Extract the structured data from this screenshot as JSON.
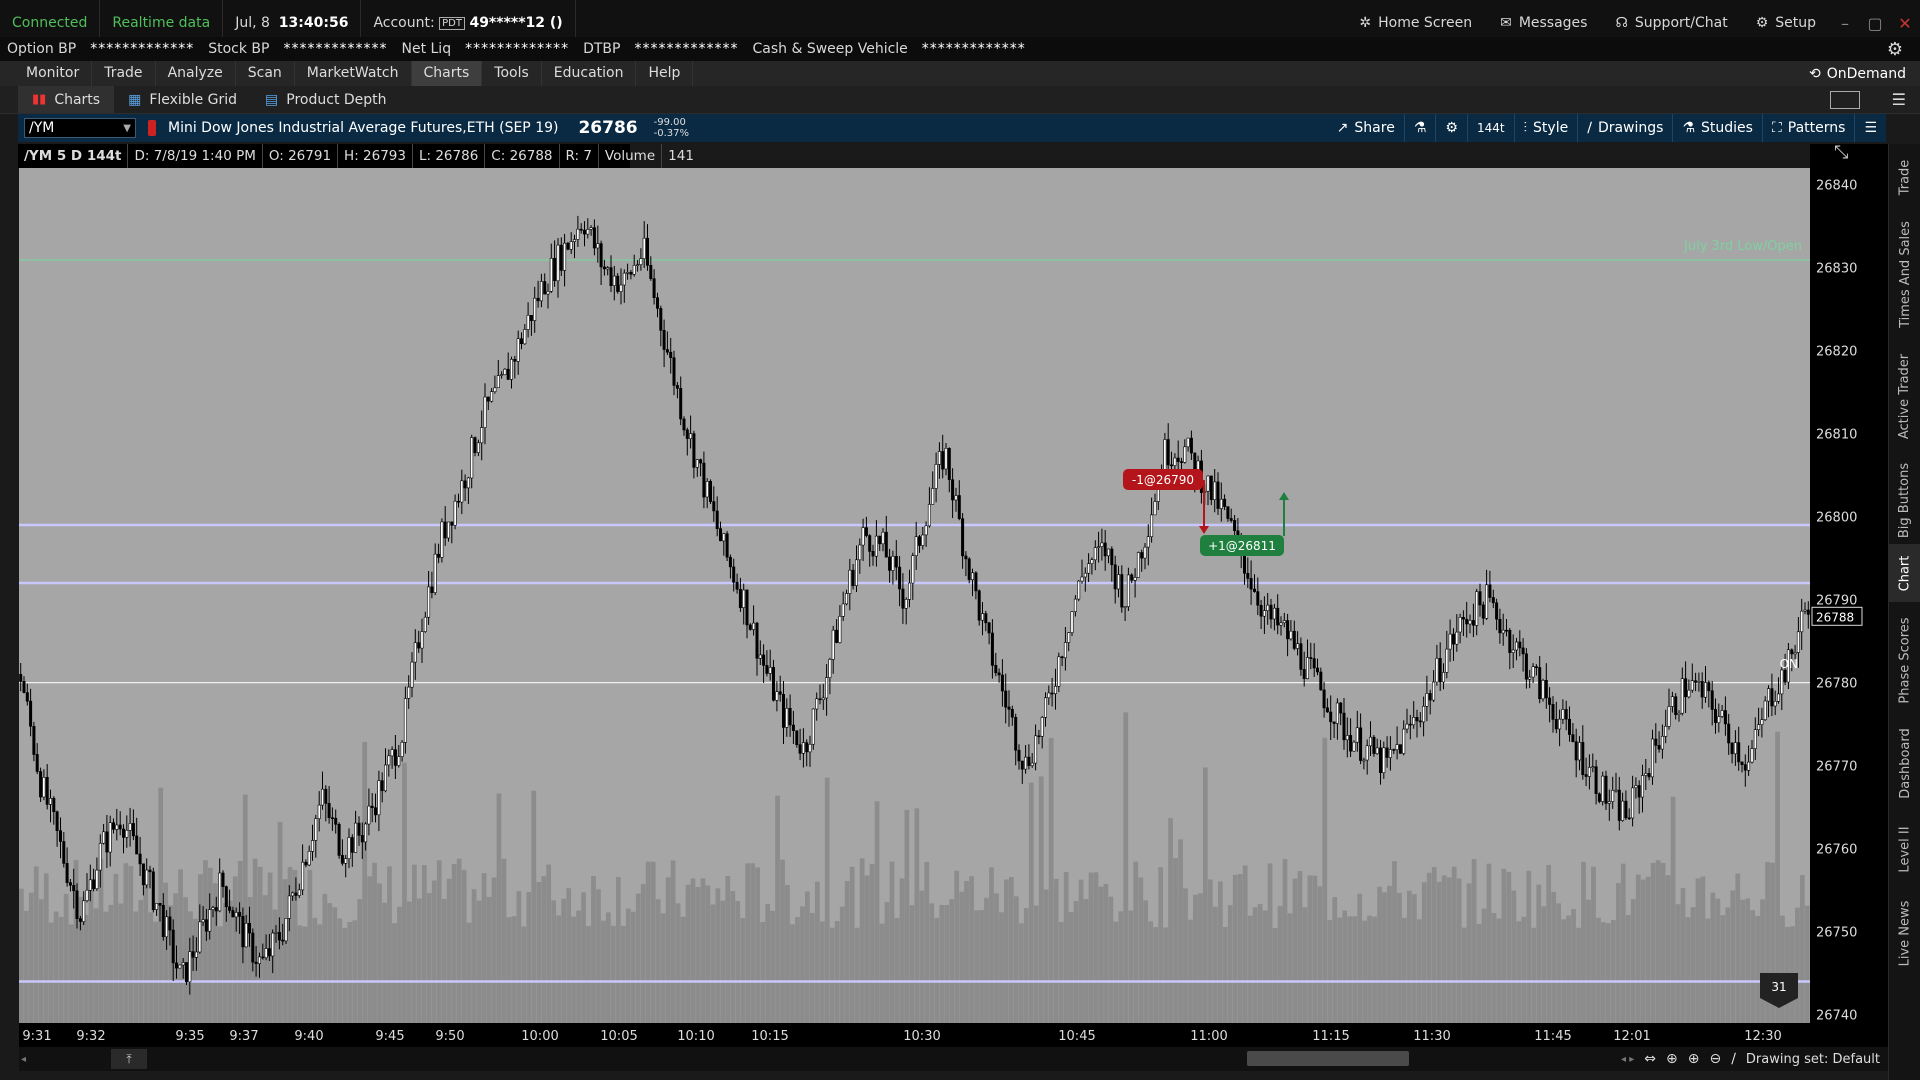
{
  "status": {
    "connected": "Connected",
    "realtime": "Realtime data",
    "date": "Jul, 8",
    "time": "13:40:56",
    "account_label": "Account:",
    "account_badge": "PDT",
    "account_value": "49*****12 ()",
    "home": "Home Screen",
    "messages": "Messages",
    "support": "Support/Chat",
    "setup": "Setup"
  },
  "account_bar": [
    {
      "label": "Option BP",
      "value": "*************"
    },
    {
      "label": "Stock BP",
      "value": "*************"
    },
    {
      "label": "Net Liq",
      "value": "*************"
    },
    {
      "label": "DTBP",
      "value": "*************"
    },
    {
      "label": "Cash & Sweep Vehicle",
      "value": "*************"
    }
  ],
  "menu": [
    "Monitor",
    "Trade",
    "Analyze",
    "Scan",
    "MarketWatch",
    "Charts",
    "Tools",
    "Education",
    "Help"
  ],
  "menu_active": "Charts",
  "ondemand": "OnDemand",
  "subtabs": [
    "Charts",
    "Flexible Grid",
    "Product Depth"
  ],
  "chart_header": {
    "symbol": "/YM",
    "description": "Mini Dow Jones Industrial Average Futures,ETH (SEP 19)",
    "price": "26786",
    "change": "-99.00",
    "change_pct": "-0.37%",
    "share": "Share",
    "aggregation": "144t",
    "style": "Style",
    "drawings": "Drawings",
    "studies": "Studies",
    "patterns": "Patterns"
  },
  "info_bar": {
    "title": "/YM 5 D 144t",
    "date": "D: 7/8/19 1:40 PM",
    "open": "O: 26791",
    "high": "H: 26793",
    "low": "L: 26786",
    "close": "C: 26788",
    "range": "R: 7",
    "volume_label": "Volume",
    "volume_value": "141"
  },
  "colors": {
    "plot_bg": "#a6a6a6",
    "volume": "#8c8c8c",
    "level_line": "#c8c8ff",
    "july_line": "#7fd1a0",
    "sell_tag": "#b3151b",
    "buy_tag": "#1e7f3e",
    "header_bg": "#0a2a43"
  },
  "chart_data": {
    "type": "candlestick",
    "y_ticks": [
      "26840",
      "26830",
      "26820",
      "26810",
      "26800",
      "26790",
      "26780",
      "26770",
      "26760",
      "26750",
      "26740"
    ],
    "ylim": [
      26739,
      26842
    ],
    "x_ticks": [
      "9:31",
      "9:32",
      "9:35",
      "9:37",
      "9:40",
      "9:45",
      "9:50",
      "10:00",
      "10:05",
      "10:10",
      "10:15",
      "10:30",
      "10:45",
      "11:00",
      "11:15",
      "11:30",
      "11:45",
      "12:01",
      "12:30"
    ],
    "current_price_label": "26788",
    "close_series": [
      26781,
      26768,
      26760,
      26752,
      26760,
      26764,
      26758,
      26752,
      26744,
      26750,
      26756,
      26750,
      26746,
      26750,
      26758,
      26766,
      26760,
      26762,
      26768,
      26774,
      26788,
      26798,
      26804,
      26812,
      26816,
      26822,
      26828,
      26832,
      26836,
      26830,
      26828,
      26832,
      26822,
      26812,
      26804,
      26796,
      26790,
      26782,
      26776,
      26772,
      26780,
      26790,
      26798,
      26796,
      26790,
      26800,
      26808,
      26796,
      26786,
      26778,
      26770,
      26776,
      26786,
      26794,
      26796,
      26790,
      26798,
      26808,
      26808,
      26804,
      26800,
      26794,
      26788,
      26786,
      26782,
      26778,
      26774,
      26772,
      26770,
      26774,
      26778,
      26784,
      26788,
      26790,
      26786,
      26782,
      26778,
      26774,
      26770,
      26766,
      26764,
      26770,
      26776,
      26780,
      26778,
      26774,
      26770,
      26778,
      26782,
      26790
    ],
    "levels": [
      {
        "value": 26830.9,
        "label": "July 3rd Low/Open"
      },
      {
        "value": 26799
      },
      {
        "value": 26792
      },
      {
        "value": 26780
      },
      {
        "value": 26744
      }
    ],
    "trades": [
      {
        "label": "-1@26790",
        "side": "sell"
      },
      {
        "label": "+1@26811",
        "side": "buy"
      }
    ],
    "on_label": "ON",
    "days_badge": "31"
  },
  "bottom": {
    "drawing_set": "Drawing set: Default"
  },
  "right_tabs": [
    "Trade",
    "Times And Sales",
    "Active Trader",
    "Big Buttons",
    "Chart",
    "Phase Scores",
    "Dashboard",
    "Level II",
    "Live News"
  ],
  "right_tab_active": "Chart"
}
